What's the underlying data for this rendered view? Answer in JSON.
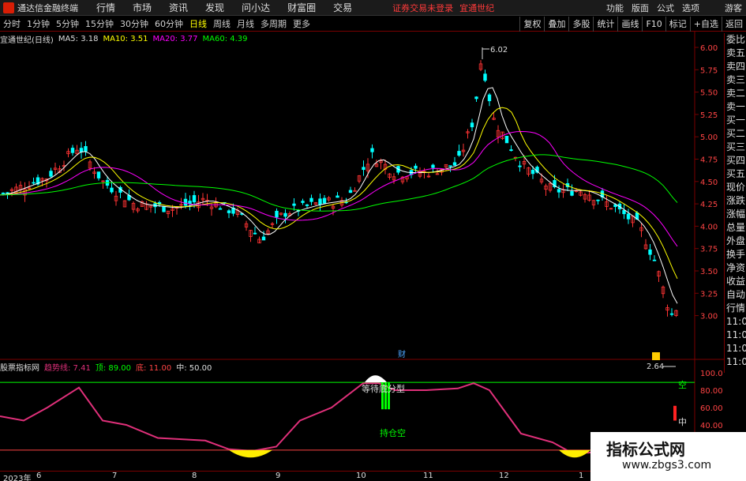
{
  "titlebar": {
    "app_title": "通达信金融终端",
    "menu": [
      "行情",
      "市场",
      "资讯",
      "发现",
      "问小达",
      "财富圈",
      "交易"
    ],
    "notice": "证券交易未登录",
    "stock_name": "宜通世纪",
    "right_menu": [
      "功能",
      "版面",
      "公式",
      "选项"
    ],
    "guest": "游客"
  },
  "toolbar": {
    "periods": [
      "分时",
      "1分钟",
      "5分钟",
      "15分钟",
      "30分钟",
      "60分钟",
      "日线",
      "周线",
      "月线",
      "多周期",
      "更多"
    ],
    "active_period": "日线",
    "right_buttons": [
      "复权",
      "叠加",
      "多股",
      "统计",
      "画线",
      "F10",
      "标记",
      "+自选",
      "返回"
    ]
  },
  "chart_head": {
    "title": "宜通世纪(日线)",
    "ma5": "MA5: 3.18",
    "ma10": "MA10: 3.51",
    "ma20": "MA20: 3.77",
    "ma60": "MA60: 4.39"
  },
  "price_axis": [
    "6.00",
    "5.75",
    "5.50",
    "5.25",
    "5.00",
    "4.75",
    "4.50",
    "4.25",
    "4.00",
    "3.75",
    "3.50",
    "3.25",
    "3.00"
  ],
  "annotations": {
    "high": "6.02",
    "low": "2.64",
    "cai": "财"
  },
  "side_panel": [
    "委比",
    "卖五",
    "卖四",
    "卖三",
    "卖二",
    "卖一",
    "买一",
    "买二",
    "买三",
    "买四",
    "买五",
    "现价",
    "涨跌",
    "涨幅",
    "总量",
    "外盘",
    "换手",
    "净资",
    "收益",
    "自动",
    "行情",
    "11:0",
    "11:0",
    "11:0",
    "11:0"
  ],
  "indicator": {
    "name": "股票指标网",
    "trend": "趋势线: 7.41",
    "top": "顶: 89.00",
    "bottom": "底: 11.00",
    "mid": "中: 50.00",
    "axis": [
      "100.0",
      "80.00",
      "60.00",
      "40.00"
    ],
    "label_wait": "等待底分型",
    "label_empty": "持仓空",
    "label_right_empty": "空",
    "label_mid": "中"
  },
  "dates": [
    "2023年",
    "6",
    "7",
    "8",
    "9",
    "10",
    "11",
    "12",
    "1"
  ],
  "watermark": {
    "title": "指标公式网",
    "url": "www.zbgs3.com"
  },
  "colors": {
    "up": "#ff3333",
    "down": "#00ffff",
    "ma5": "#ffffff",
    "ma10": "#ffff00",
    "ma20": "#ff00ff",
    "ma60": "#00ff00",
    "trend": "#e0307a"
  }
}
